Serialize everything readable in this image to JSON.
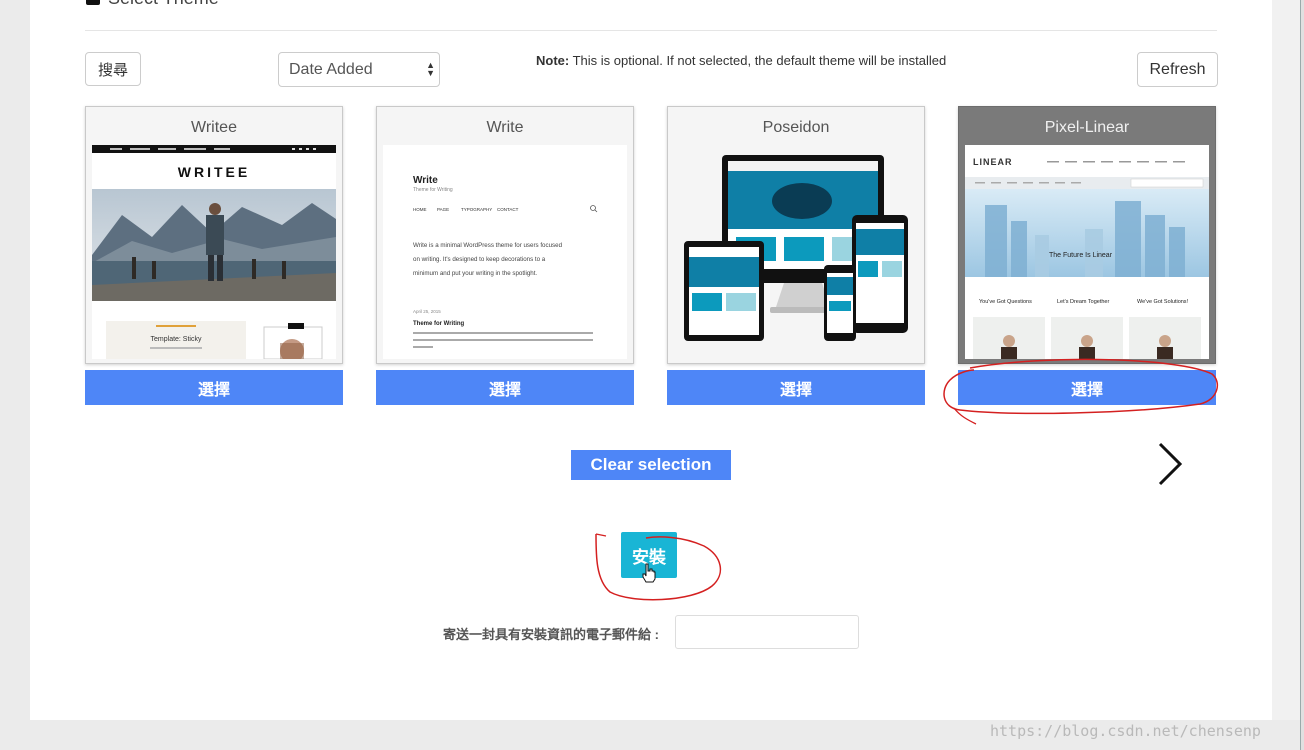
{
  "section": {
    "title": "Select Theme"
  },
  "toolbar": {
    "search_label": "搜尋",
    "sort_value": "Date Added",
    "note_bold": "Note:",
    "note_text": " This is optional. If not selected, the default theme will be installed",
    "refresh_label": "Refresh"
  },
  "themes": [
    {
      "name": "Writee",
      "select_label": "選擇",
      "preview": {
        "logo": "WRITEE",
        "caption": "Template: Sticky"
      }
    },
    {
      "name": "Write",
      "select_label": "選擇",
      "preview": {
        "site_title": "Write",
        "tagline": "Theme for Writing",
        "nav": [
          "HOME",
          "PAGE",
          "TYPOGRAPHY",
          "CONTACT"
        ],
        "intro_lines": [
          "Write is a minimal WordPress theme for users focused",
          "on writing. It's designed to keep decorations to a",
          "minimum and put your writing in the spotlight."
        ],
        "post_date": "April 25, 2015",
        "post_title": "Theme for Writing"
      }
    },
    {
      "name": "Poseidon",
      "select_label": "選擇",
      "preview": {}
    },
    {
      "name": "Pixel-Linear",
      "select_label": "選擇",
      "selected": true,
      "preview": {
        "logo": "LINEAR",
        "hero_text": "The Future Is Linear",
        "columns": [
          "You've Got Questions",
          "Let's Dream Together",
          "We've Got Solutions!"
        ]
      }
    }
  ],
  "actions": {
    "clear_label": "Clear selection",
    "install_label": "安裝",
    "next_icon": "chevron-right-icon"
  },
  "email": {
    "label": "寄送一封具有安裝資訊的電子郵件給 :",
    "value": ""
  },
  "watermark": "https://blog.csdn.net/chensenp",
  "colors": {
    "select_button": "#4e86f7",
    "install_button": "#19b5d5",
    "annotation": "#d42020",
    "selected_card": "#7a7a7a"
  }
}
